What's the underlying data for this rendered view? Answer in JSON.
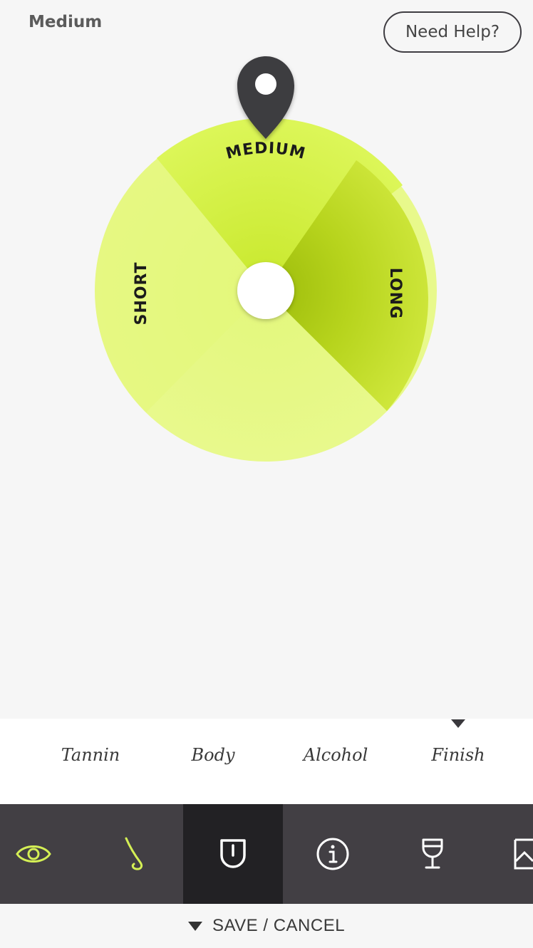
{
  "header": {
    "selected_value": "Medium",
    "help_label": "Need Help?"
  },
  "wheel": {
    "segments": [
      "MEDIUM",
      "LONG",
      "SHORT"
    ],
    "pointer_on": "MEDIUM",
    "colors": {
      "light": "#e7f98a",
      "mid": "#d8f353",
      "dark": "#a4c40f",
      "pointer": "#3e3c40"
    }
  },
  "categories": {
    "items": [
      "Tannin",
      "Body",
      "Alcohol",
      "Finish"
    ],
    "active": "Finish"
  },
  "toolbar": {
    "icons": [
      "eye-icon",
      "nose-icon",
      "palate-icon",
      "info-icon",
      "wine-glass-icon",
      "image-icon"
    ],
    "active": "palate-icon",
    "accent": "#d4ef55"
  },
  "footer": {
    "label": "SAVE / CANCEL"
  }
}
